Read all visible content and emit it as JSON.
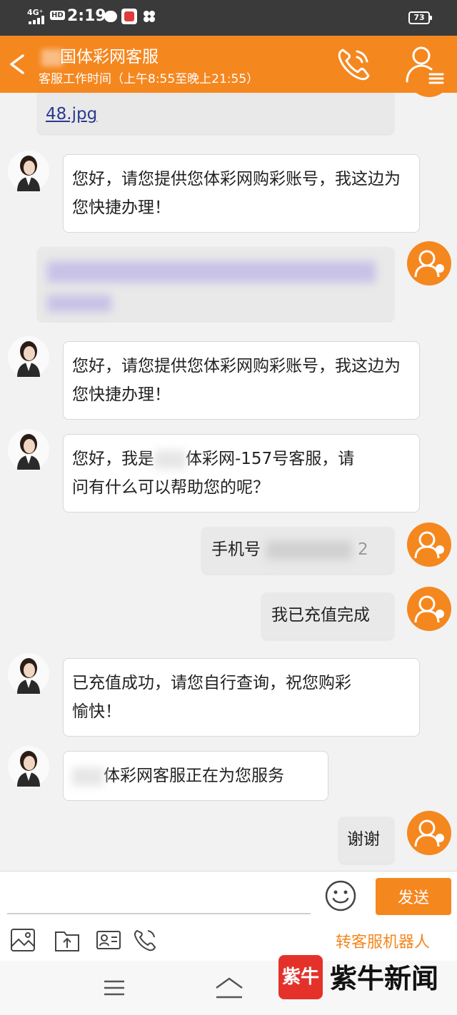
{
  "status_bar": {
    "network": "4G⁺",
    "hd": "HD",
    "time": "2:19",
    "battery": "73"
  },
  "header": {
    "title": "国体彩网客服",
    "subtitle": "客服工作时间（上午8:55至晚上21:55）"
  },
  "messages": [
    {
      "id": "m0",
      "side": "right",
      "text": "48.jpg"
    },
    {
      "id": "m1",
      "side": "left",
      "text": "您好，请您提供您体彩网购彩账号，我这边为您快捷办理！"
    },
    {
      "id": "m2",
      "side": "right",
      "text": ""
    },
    {
      "id": "m3",
      "side": "left",
      "text": "您好，请您提供您体彩网购彩账号，我这边为您快捷办理！"
    },
    {
      "id": "m4",
      "side": "left",
      "line1a": "您好，我是",
      "line1b": "体彩网-157号客服，请",
      "line2": "问有什么可以帮助您的呢？"
    },
    {
      "id": "m5",
      "side": "right",
      "prefix": "手机号",
      "suffix": "2"
    },
    {
      "id": "m6",
      "side": "right",
      "text": "我已充值完成"
    },
    {
      "id": "m7",
      "side": "left",
      "line1": "已充值成功，请您自行查询，祝您购彩",
      "line2": "愉快！"
    },
    {
      "id": "m8",
      "side": "left",
      "text": "体彩网客服正在为您服务"
    },
    {
      "id": "m9",
      "side": "right",
      "text": "谢谢"
    }
  ],
  "input": {
    "placeholder": "",
    "send_label": "发送"
  },
  "toolbar": {
    "robot_label": "转客服机器人"
  },
  "watermark": {
    "logo_text": "紫牛",
    "brand": "紫牛新闻"
  },
  "colors": {
    "accent": "#f5871f",
    "status_bar": "#3a3a3a"
  }
}
